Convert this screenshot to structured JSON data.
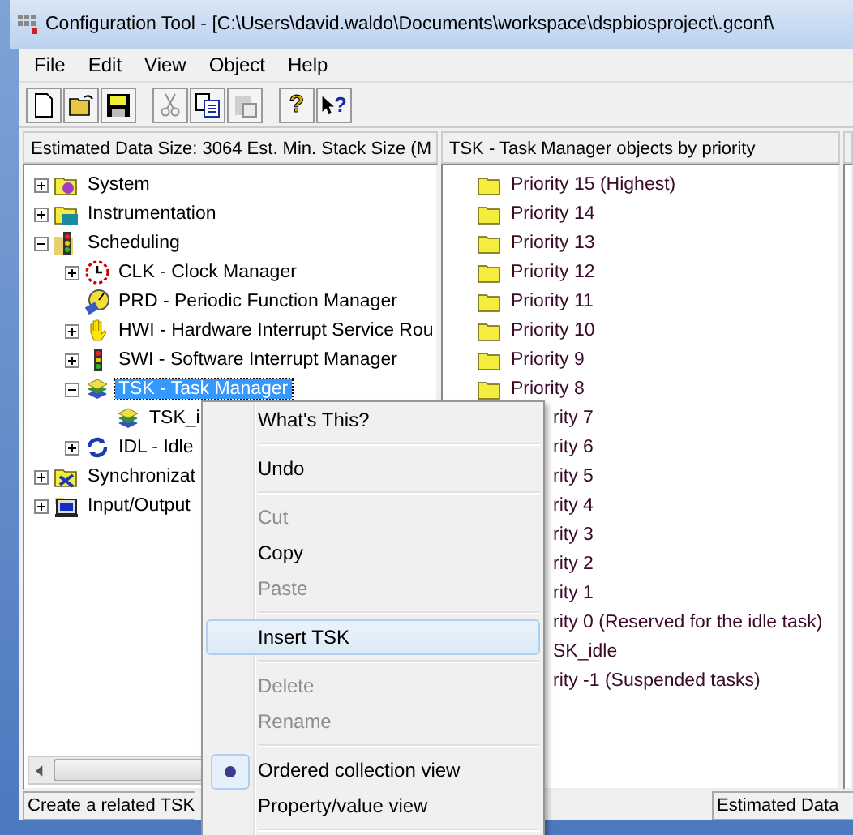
{
  "window": {
    "title": "Configuration Tool - [C:\\Users\\david.waldo\\Documents\\workspace\\dspbiosproject\\.gconf\\"
  },
  "menu_bar": [
    "File",
    "Edit",
    "View",
    "Object",
    "Help"
  ],
  "toolbar": [
    {
      "kind": "new",
      "disabled": false
    },
    {
      "kind": "open",
      "disabled": false
    },
    {
      "kind": "save",
      "disabled": false
    },
    {
      "kind": "separator"
    },
    {
      "kind": "cut",
      "disabled": true
    },
    {
      "kind": "copy",
      "disabled": false
    },
    {
      "kind": "paste",
      "disabled": true
    },
    {
      "kind": "separator"
    },
    {
      "kind": "help",
      "glyph": "?",
      "disabled": false
    },
    {
      "kind": "context-help",
      "glyph": "?",
      "disabled": false
    }
  ],
  "left_panel": {
    "header": "Estimated Data Size: 3064   Est. Min. Stack Size (M",
    "items": [
      {
        "label": "System",
        "kind": "system",
        "expanded": false,
        "selected": false
      },
      {
        "label": "Instrumentation",
        "kind": "instrumentation",
        "expanded": false,
        "selected": false
      },
      {
        "label": "Scheduling",
        "kind": "scheduling",
        "expanded": true,
        "selected": false,
        "children": [
          {
            "label": "CLK - Clock Manager",
            "kind": "clock",
            "expanded": false,
            "selected": false
          },
          {
            "label": "PRD - Periodic Function Manager",
            "kind": "dial",
            "selected": false
          },
          {
            "label": "HWI - Hardware Interrupt Service Rou",
            "kind": "hand",
            "expanded": false,
            "selected": false
          },
          {
            "label": "SWI - Software Interrupt Manager",
            "kind": "traffic",
            "expanded": false,
            "selected": false
          },
          {
            "label": "TSK - Task Manager",
            "kind": "books",
            "expanded": true,
            "selected": true,
            "children": [
              {
                "label": "TSK_i",
                "kind": "book",
                "selected": false
              }
            ]
          },
          {
            "label": "IDL - Idle",
            "kind": "cycle",
            "expanded": false,
            "selected": false
          }
        ]
      },
      {
        "label": "Synchronizat",
        "kind": "sync",
        "expanded": false,
        "selected": false
      },
      {
        "label": "Input/Output",
        "kind": "io",
        "expanded": false,
        "selected": false
      }
    ],
    "status": "Create a related TSK"
  },
  "middle_panel": {
    "header": "TSK - Task Manager objects by priority",
    "items": [
      {
        "label": "Priority 15 (Highest)"
      },
      {
        "label": "Priority 14"
      },
      {
        "label": "Priority 13"
      },
      {
        "label": "Priority 12"
      },
      {
        "label": "Priority 11"
      },
      {
        "label": "Priority 10"
      },
      {
        "label": "Priority 9"
      },
      {
        "label": "Priority 8"
      },
      {
        "label": "rity 7"
      },
      {
        "label": "rity 6"
      },
      {
        "label": "rity 5"
      },
      {
        "label": "rity 4"
      },
      {
        "label": "rity 3"
      },
      {
        "label": "rity 2"
      },
      {
        "label": "rity 1"
      },
      {
        "label": "rity 0 (Reserved for the idle task)",
        "children": [
          {
            "label": "SK_idle"
          }
        ]
      },
      {
        "label": "rity -1 (Suspended tasks)"
      }
    ]
  },
  "right_panel": {
    "status": "Estimated Data"
  },
  "context_menu": [
    {
      "kind": "item",
      "label": "What's This?",
      "disabled": false,
      "selected": false
    },
    {
      "kind": "separator"
    },
    {
      "kind": "item",
      "label": "Undo",
      "disabled": false,
      "selected": false
    },
    {
      "kind": "separator"
    },
    {
      "kind": "item",
      "label": "Cut",
      "disabled": true,
      "selected": false
    },
    {
      "kind": "item",
      "label": "Copy",
      "disabled": false,
      "selected": false
    },
    {
      "kind": "item",
      "label": "Paste",
      "disabled": true,
      "selected": false
    },
    {
      "kind": "separator"
    },
    {
      "kind": "item",
      "label": "Insert TSK",
      "disabled": false,
      "selected": true
    },
    {
      "kind": "separator"
    },
    {
      "kind": "item",
      "label": "Delete",
      "disabled": true,
      "selected": false
    },
    {
      "kind": "item",
      "label": "Rename",
      "disabled": true,
      "selected": false
    },
    {
      "kind": "separator"
    },
    {
      "kind": "radio",
      "label": "Ordered collection view",
      "disabled": false,
      "selected": false,
      "checked": true
    },
    {
      "kind": "radio",
      "label": "Property/value view",
      "disabled": false,
      "selected": false,
      "checked": false
    },
    {
      "kind": "separator"
    }
  ]
}
